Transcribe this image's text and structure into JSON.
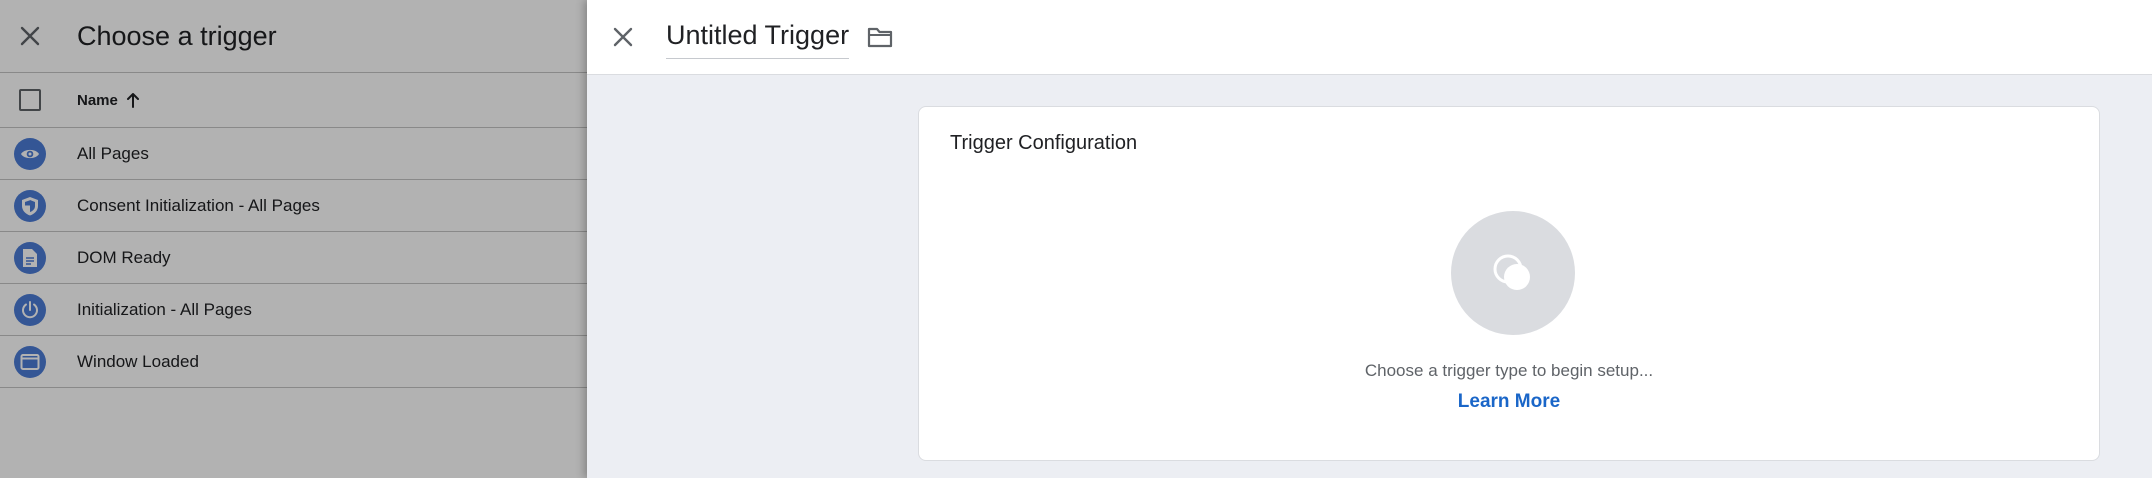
{
  "left_panel": {
    "title": "Choose a trigger",
    "column_header": "Name",
    "sort_icon": "arrow-up-icon",
    "close_icon": "close-icon",
    "triggers": [
      {
        "label": "All Pages",
        "icon": "eye-icon"
      },
      {
        "label": "Consent Initialization - All Pages",
        "icon": "shield-icon"
      },
      {
        "label": "DOM Ready",
        "icon": "document-icon"
      },
      {
        "label": "Initialization - All Pages",
        "icon": "power-icon"
      },
      {
        "label": "Window Loaded",
        "icon": "window-icon"
      }
    ]
  },
  "right_panel": {
    "trigger_name": "Untitled Trigger",
    "close_icon": "close-icon",
    "folder_icon": "folder-icon",
    "config": {
      "title": "Trigger Configuration",
      "placeholder_icon": "trigger-type-icon",
      "hint": "Choose a trigger type to begin setup...",
      "learn_more": "Learn More"
    }
  },
  "colors": {
    "accent_blue": "#1a66c8",
    "icon_blue": "#4b7bd6",
    "placeholder_grey": "#dadce0",
    "scrim": "rgba(0,0,0,0.30)"
  }
}
